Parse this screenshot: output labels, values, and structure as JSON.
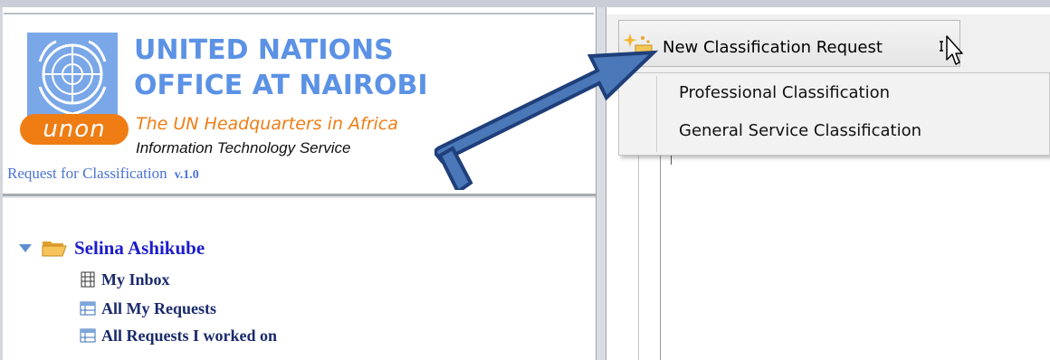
{
  "header": {
    "org_line1": "UNITED NATIONS",
    "org_line2": "OFFICE AT NAIROBI",
    "badge": "unon",
    "tagline": "The UN Headquarters in Africa",
    "subline": "Information Technology Service",
    "app_title": "Request for Classification",
    "app_version": "v.1.0",
    "emblem_icon": "un-emblem-icon"
  },
  "tree": {
    "root_label": "Selina Ashikube",
    "root_icons": [
      "chevron-down-icon",
      "folder-open-icon"
    ],
    "items": [
      {
        "label": "My Inbox",
        "icon": "inbox-icon"
      },
      {
        "label": "All My Requests",
        "icon": "table-icon"
      },
      {
        "label": "All Requests I worked on",
        "icon": "table-icon"
      }
    ]
  },
  "toolbar": {
    "new_request_label": "New Classification Request",
    "new_request_icon": "sparkle-folder-icon"
  },
  "menu": {
    "items": [
      "Professional Classification",
      "General Service Classification"
    ]
  },
  "colors": {
    "un_blue": "#5b92e5",
    "unon_orange": "#ef7d14",
    "tree_root": "#1c1ccc",
    "tree_item": "#1a2a6c",
    "arrow_fill": "#4a78b8",
    "arrow_stroke": "#1f3f7a"
  }
}
